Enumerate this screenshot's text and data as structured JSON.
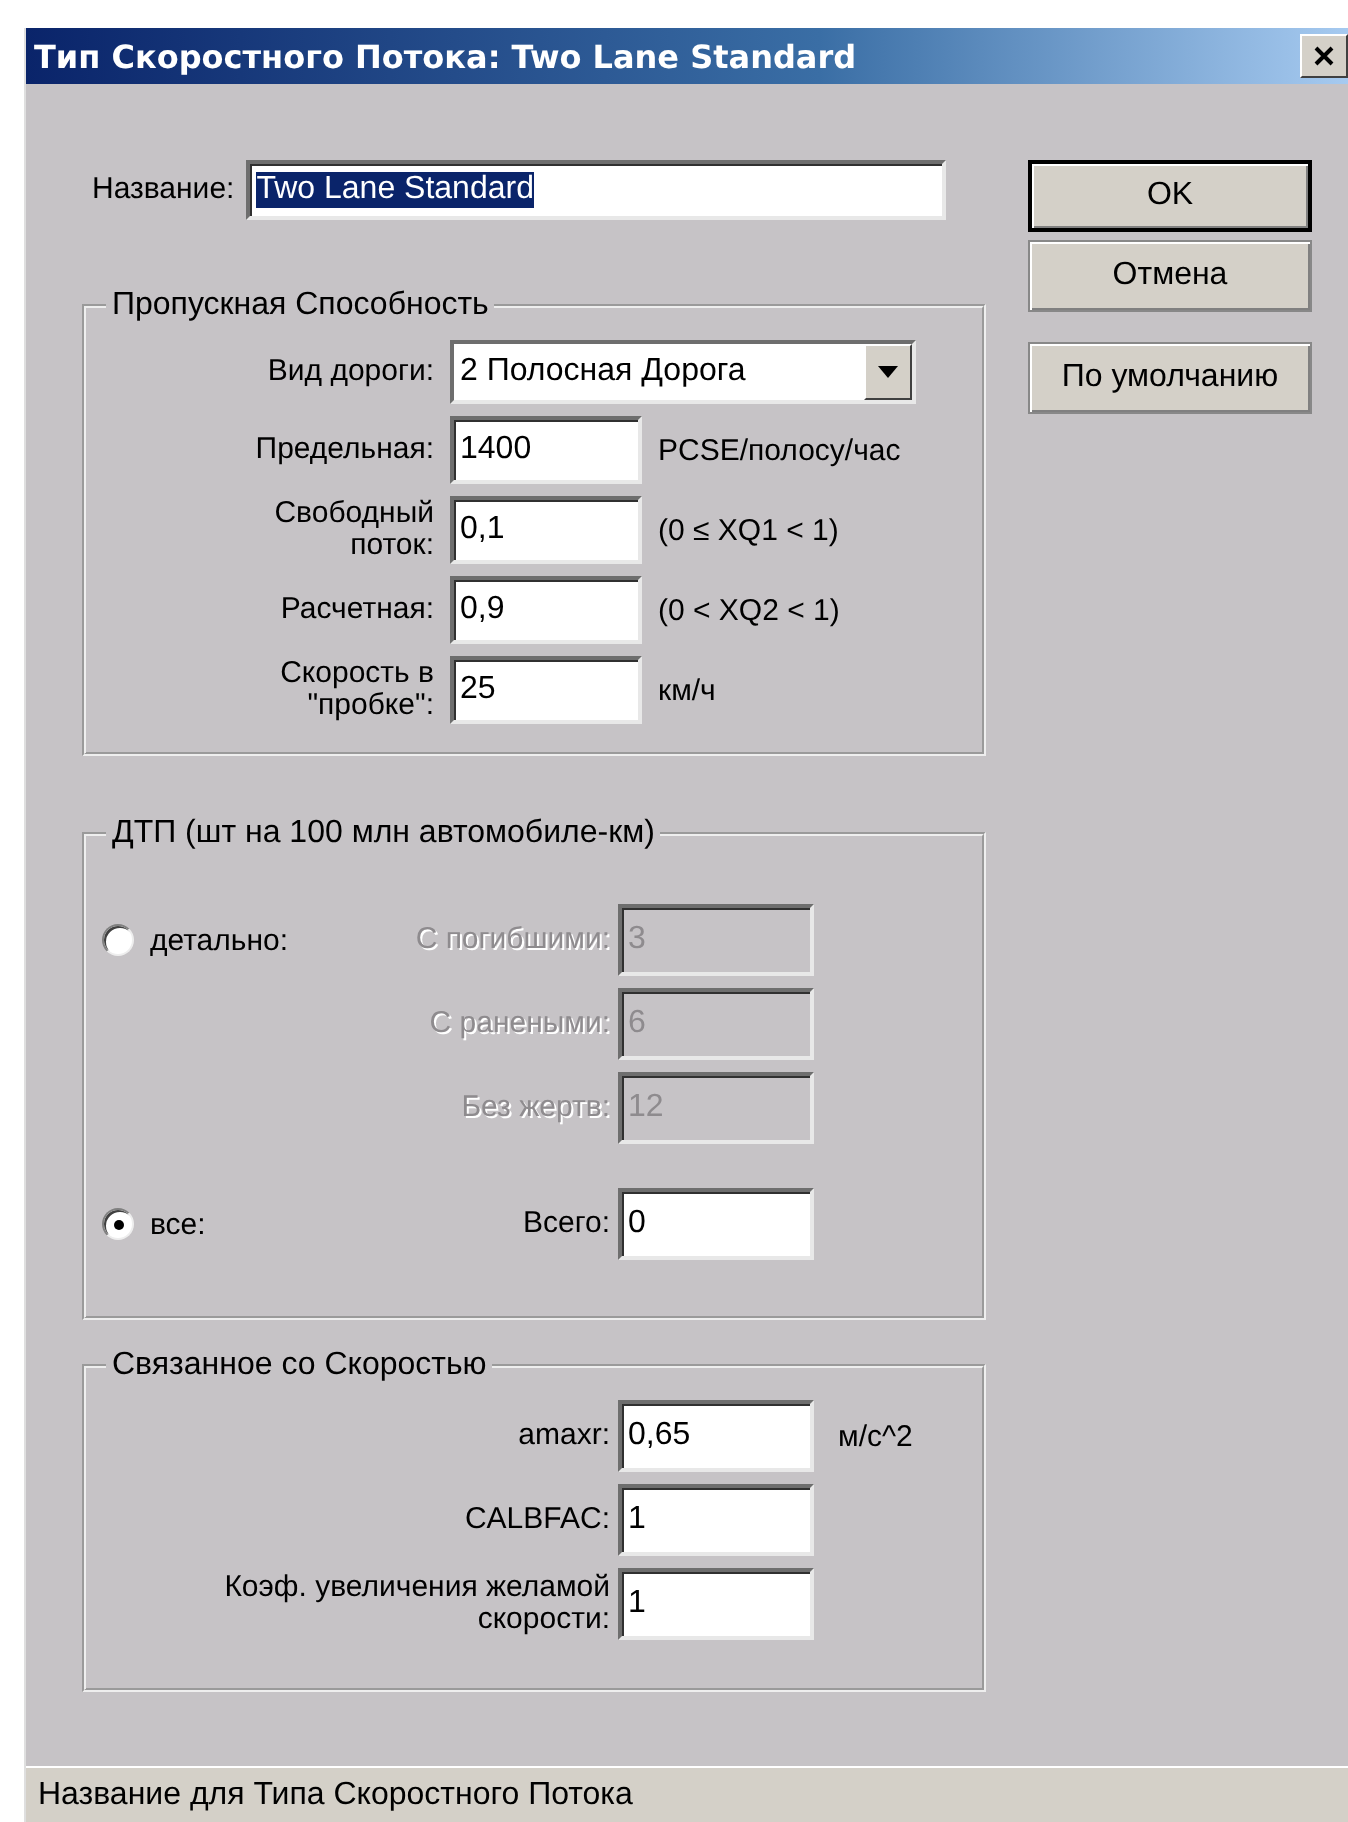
{
  "window": {
    "title": "Тип Скоростного Потока: Two Lane Standard"
  },
  "name_field": {
    "label": "Название:",
    "value": "Two Lane Standard",
    "text_selected": true
  },
  "buttons": [
    {
      "label": "OK",
      "default": true
    },
    {
      "label": "Отмена",
      "default": false
    },
    {
      "label": "По умолчанию",
      "default": false
    }
  ],
  "capacity": {
    "title": "Пропускная Способность",
    "road_type": {
      "label": "Вид дороги:",
      "value": "2 Полосная Дорога"
    },
    "fields": [
      {
        "label": "Предельная:",
        "value": "1400",
        "suffix": "PCSE/полосу/час"
      },
      {
        "label": "Свободный поток:",
        "value": "0,1",
        "suffix": "(0 ≤ XQ1 < 1)"
      },
      {
        "label": "Расчетная:",
        "value": "0,9",
        "suffix": "(0 < XQ2 < 1)"
      },
      {
        "label": "Скорость в \"пробке\":",
        "value": "25",
        "suffix": "км/ч"
      }
    ]
  },
  "accidents": {
    "title": "ДТП (шт на 100 млн автомобиле-км)",
    "modes": [
      {
        "label": "детально:",
        "selected": false
      },
      {
        "label": "все:",
        "selected": true
      }
    ],
    "detail_fields": [
      {
        "label": "С погибшими:",
        "value": "3",
        "disabled": true
      },
      {
        "label": "С ранеными:",
        "value": "6",
        "disabled": true
      },
      {
        "label": "Без жертв:",
        "value": "12",
        "disabled": true
      }
    ],
    "total": {
      "label": "Всего:",
      "value": "0"
    }
  },
  "speed": {
    "title": "Связанное со Скоростью",
    "fields": [
      {
        "label": "amaxr:",
        "value": "0,65",
        "suffix": "м/с^2"
      },
      {
        "label": "CALBFAC:",
        "value": "1"
      },
      {
        "label": "Коэф. увеличения желамой скорости:",
        "value": "1"
      }
    ]
  },
  "status_bar": {
    "text": "Название для Типа Скоростного Потока"
  }
}
